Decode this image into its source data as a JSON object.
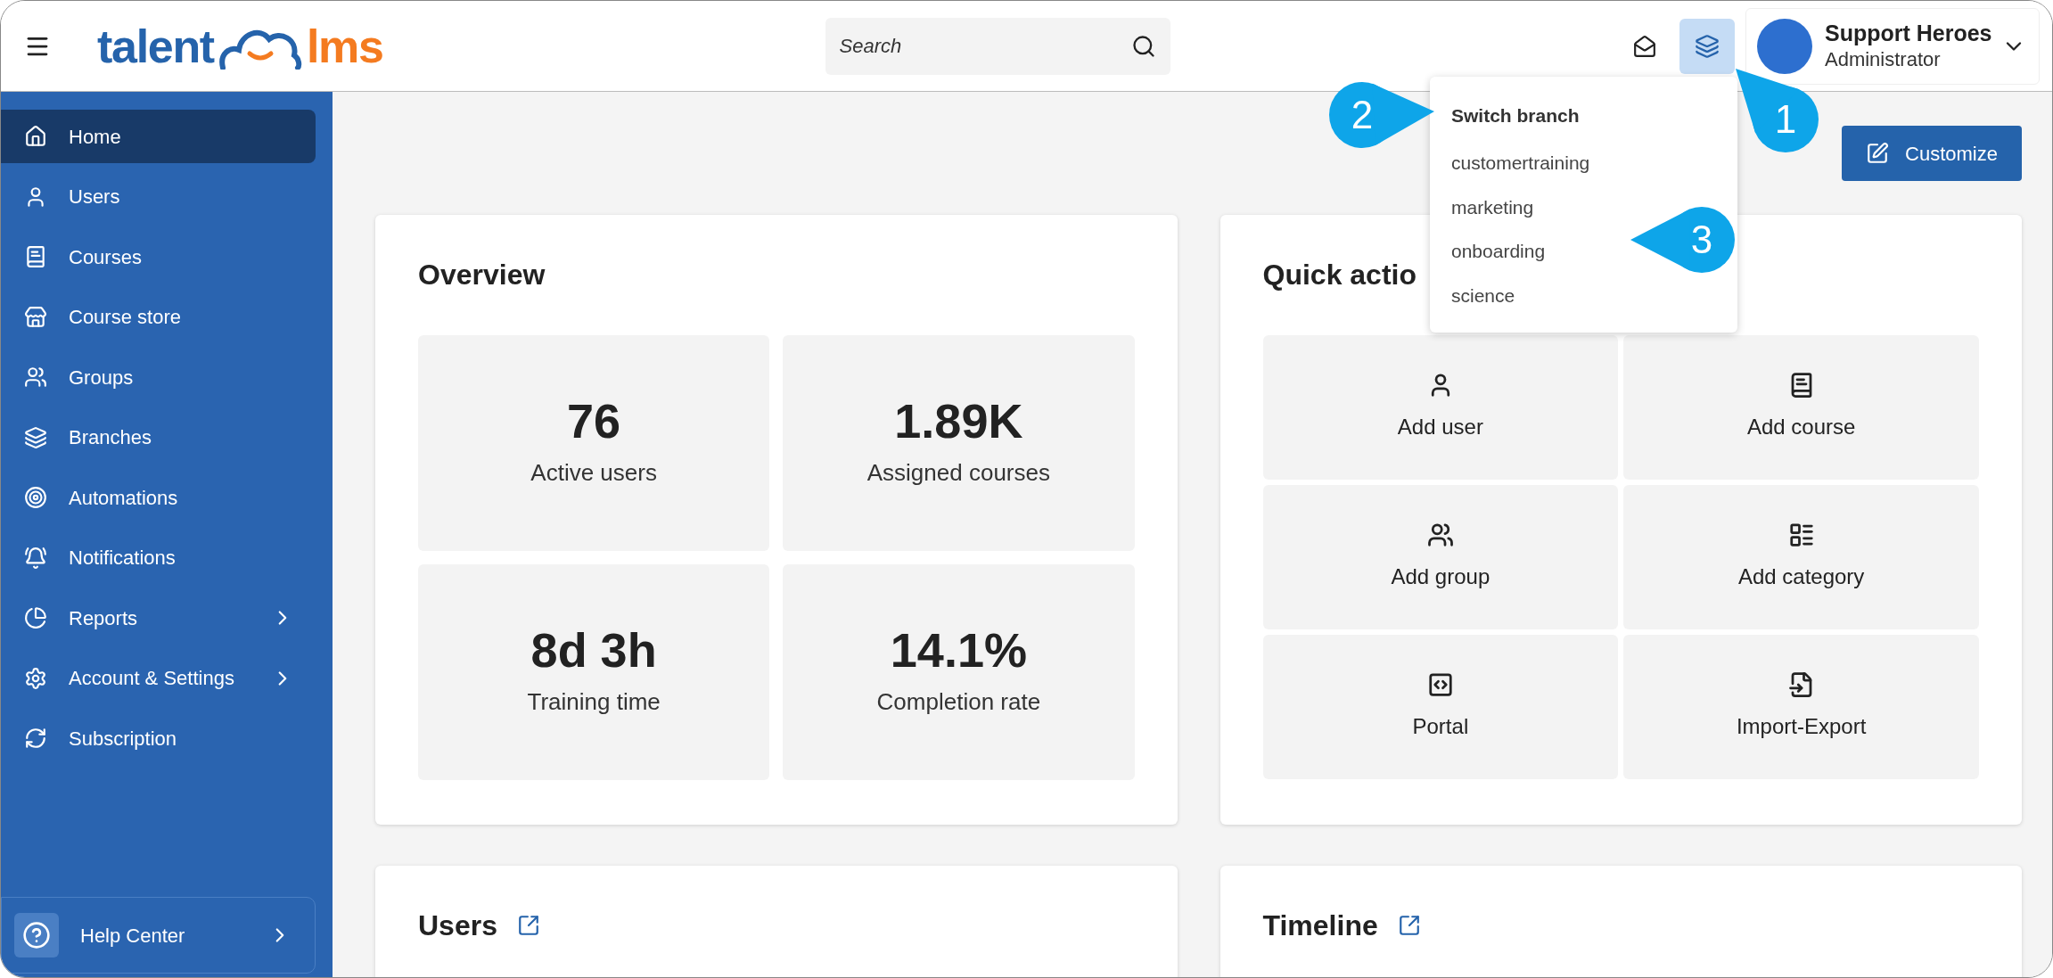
{
  "header": {
    "logo": {
      "left": "talent",
      "right": "lms"
    },
    "search": {
      "placeholder": "Search"
    },
    "branch_button": {
      "active": true
    },
    "user": {
      "name": "Support Heroes",
      "role": "Administrator"
    }
  },
  "branch_menu": {
    "title": "Switch branch",
    "items": [
      "customertraining",
      "marketing",
      "onboarding",
      "science"
    ]
  },
  "callouts": [
    {
      "number": "1"
    },
    {
      "number": "2"
    },
    {
      "number": "3"
    }
  ],
  "sidebar": {
    "items": [
      {
        "label": "Home",
        "selected": true,
        "expandable": false
      },
      {
        "label": "Users",
        "selected": false,
        "expandable": false
      },
      {
        "label": "Courses",
        "selected": false,
        "expandable": false
      },
      {
        "label": "Course store",
        "selected": false,
        "expandable": false
      },
      {
        "label": "Groups",
        "selected": false,
        "expandable": false
      },
      {
        "label": "Branches",
        "selected": false,
        "expandable": false
      },
      {
        "label": "Automations",
        "selected": false,
        "expandable": false
      },
      {
        "label": "Notifications",
        "selected": false,
        "expandable": false
      },
      {
        "label": "Reports",
        "selected": false,
        "expandable": true
      },
      {
        "label": "Account & Settings",
        "selected": false,
        "expandable": true
      },
      {
        "label": "Subscription",
        "selected": false,
        "expandable": false
      }
    ],
    "help": {
      "label": "Help Center"
    }
  },
  "customize_button": "Customize",
  "overview": {
    "title": "Overview",
    "stats": [
      {
        "value": "76",
        "label": "Active users"
      },
      {
        "value": "1.89K",
        "label": "Assigned courses"
      },
      {
        "value": "8d 3h",
        "label": "Training time"
      },
      {
        "value": "14.1%",
        "label": "Completion rate"
      }
    ]
  },
  "quick_actions": {
    "title": "Quick actio",
    "actions": [
      "Add user",
      "Add course",
      "Add group",
      "Add category",
      "Portal",
      "Import-Export"
    ]
  },
  "bottom_cards": [
    {
      "title": "Users"
    },
    {
      "title": "Timeline"
    }
  ]
}
